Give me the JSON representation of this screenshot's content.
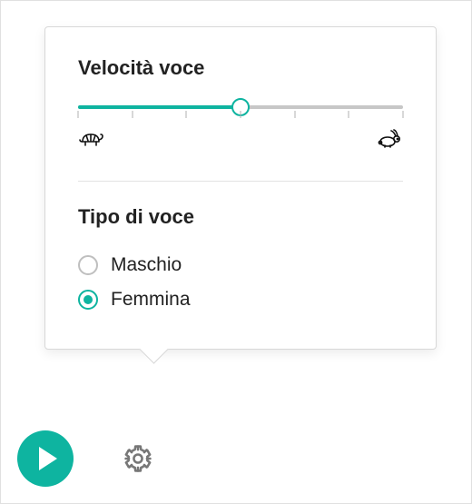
{
  "colors": {
    "accent": "#0eb4a0"
  },
  "speed": {
    "title": "Velocità voce",
    "value_percent": 50,
    "slow_icon": "turtle-icon",
    "fast_icon": "rabbit-icon"
  },
  "voice": {
    "title": "Tipo di voce",
    "options": [
      {
        "label": "Maschio",
        "selected": false
      },
      {
        "label": "Femmina",
        "selected": true
      }
    ]
  },
  "controls": {
    "play": "play-button",
    "settings": "settings-gear"
  }
}
